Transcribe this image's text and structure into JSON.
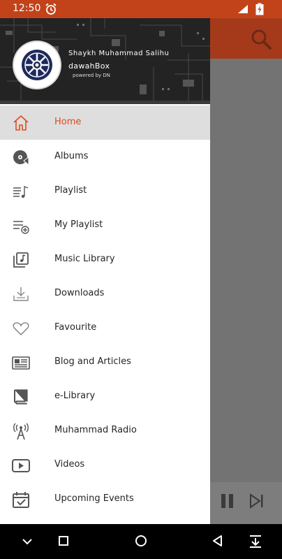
{
  "status_bar": {
    "time": "12:50",
    "icons": [
      "alarm-icon",
      "signal-icon",
      "battery-charging-icon"
    ]
  },
  "drawer": {
    "header": {
      "name": "Shaykh Muhammad Salihu",
      "app": "dawahBox",
      "powered": "powered by DN"
    },
    "items": [
      {
        "label": "Home",
        "icon": "home-icon",
        "active": true
      },
      {
        "label": "Albums",
        "icon": "album-icon"
      },
      {
        "label": "Playlist",
        "icon": "playlist-icon"
      },
      {
        "label": "My Playlist",
        "icon": "playlist-add-icon"
      },
      {
        "label": "Music Library",
        "icon": "music-library-icon"
      },
      {
        "label": "Downloads",
        "icon": "download-icon"
      },
      {
        "label": "Favourite",
        "icon": "heart-icon"
      },
      {
        "label": "Blog and Articles",
        "icon": "newspaper-icon"
      },
      {
        "label": "e-Library",
        "icon": "book-icon"
      },
      {
        "label": "Muhammad Radio",
        "icon": "radio-tower-icon"
      },
      {
        "label": "Videos",
        "icon": "video-icon"
      },
      {
        "label": "Upcoming Events",
        "icon": "calendar-check-icon"
      }
    ]
  },
  "colors": {
    "accent": "#e04a1c",
    "status_bar": "#c2431a",
    "active_item_bg": "#dedede"
  }
}
